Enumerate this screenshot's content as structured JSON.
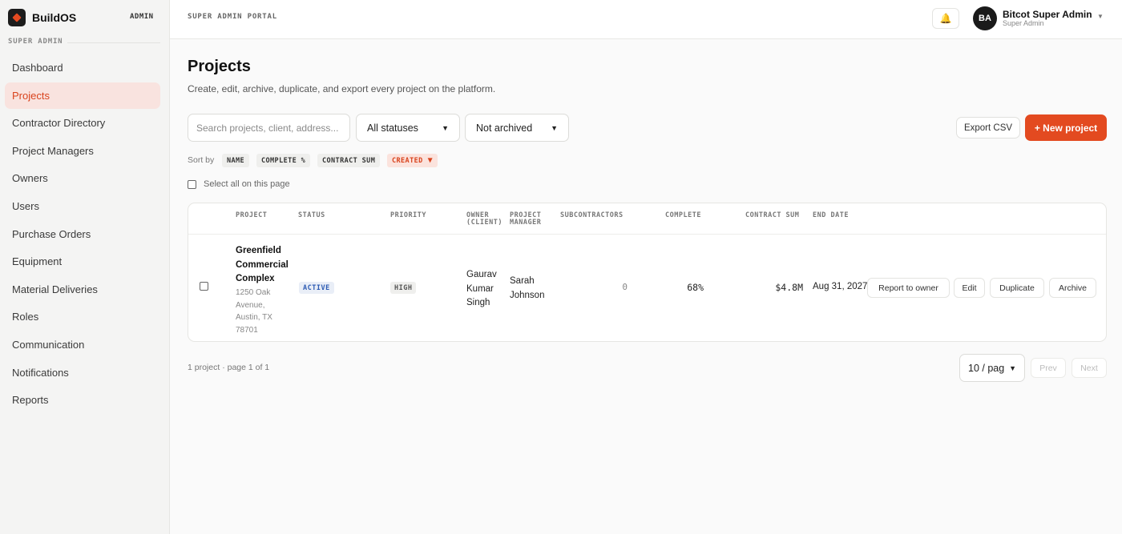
{
  "app": {
    "name": "BuildOS",
    "admin_tag": "ADMIN",
    "section_label": "SUPER ADMIN"
  },
  "sidebar": {
    "items": [
      {
        "label": "Dashboard",
        "active": false
      },
      {
        "label": "Projects",
        "active": true
      },
      {
        "label": "Contractor Directory",
        "active": false
      },
      {
        "label": "Project Managers",
        "active": false
      },
      {
        "label": "Owners",
        "active": false
      },
      {
        "label": "Users",
        "active": false
      },
      {
        "label": "Purchase Orders",
        "active": false
      },
      {
        "label": "Equipment",
        "active": false
      },
      {
        "label": "Material Deliveries",
        "active": false
      },
      {
        "label": "Roles",
        "active": false
      },
      {
        "label": "Communication",
        "active": false
      },
      {
        "label": "Notifications",
        "active": false
      },
      {
        "label": "Reports",
        "active": false
      }
    ]
  },
  "topbar": {
    "portal_label": "SUPER ADMIN PORTAL",
    "bell_icon": "bell-icon",
    "user": {
      "initials": "BA",
      "name": "Bitcot Super Admin",
      "role": "Super Admin"
    }
  },
  "page": {
    "title": "Projects",
    "subtitle": "Create, edit, archive, duplicate, and export every project on the platform."
  },
  "filters": {
    "search_placeholder": "Search projects, client, address...",
    "status_value": "All statuses",
    "archived_value": "Not archived",
    "export_label": "Export CSV",
    "new_label": "+ New project"
  },
  "sort": {
    "label": "Sort by",
    "options": [
      "NAME",
      "COMPLETE %",
      "CONTRACT SUM",
      "CREATED"
    ],
    "active": "CREATED",
    "arrow": "▼"
  },
  "select_all_label": "Select all on this page",
  "table": {
    "headers": {
      "project": "PROJECT",
      "status": "STATUS",
      "priority": "PRIORITY",
      "owner_1": "OWNER",
      "owner_2": "(CLIENT)",
      "pm_1": "PROJECT",
      "pm_2": "MANAGER",
      "subcontractors": "SUBCONTRACTORS",
      "complete": "COMPLETE",
      "contract_sum": "CONTRACT SUM",
      "end_date": "END DATE"
    },
    "rows": [
      {
        "name_lines": [
          "Greenfield",
          "Commercial",
          "Complex"
        ],
        "address_lines": [
          "1250 Oak",
          "Avenue,",
          "Austin, TX",
          "78701"
        ],
        "status": "ACTIVE",
        "priority": "HIGH",
        "owner_lines": [
          "Gaurav",
          "Kumar",
          "Singh"
        ],
        "pm_lines": [
          "Sarah",
          "Johnson"
        ],
        "subcontractors": "0",
        "complete": "68%",
        "contract_sum": "$4.8M",
        "end_date": "Aug 31, 2027",
        "actions": [
          "Report to owner",
          "Edit",
          "Duplicate",
          "Archive"
        ]
      }
    ]
  },
  "footer": {
    "info": "1 project · page 1 of 1",
    "per_page": "10 / pag",
    "prev": "Prev",
    "next": "Next"
  }
}
